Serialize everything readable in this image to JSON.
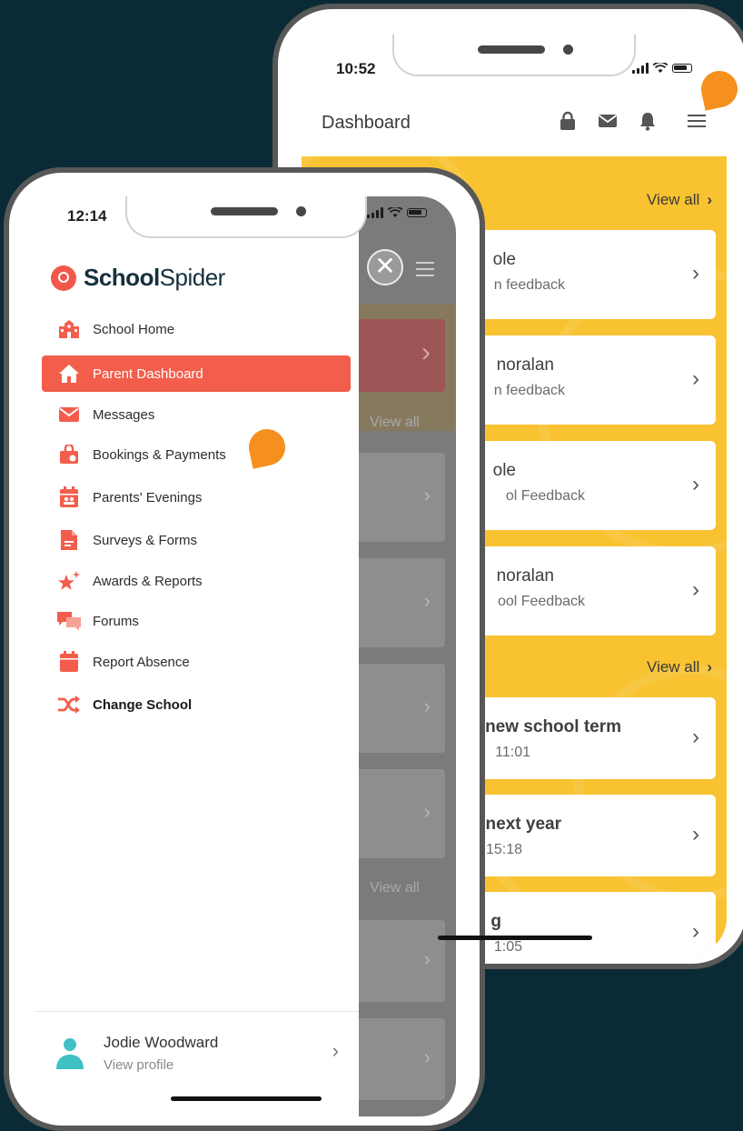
{
  "back_phone": {
    "time": "10:52",
    "header": {
      "title": "Dashboard"
    },
    "icons": {
      "lock": "lock-icon",
      "mail": "mail-icon",
      "bell": "bell-icon",
      "menu": "hamburger-icon"
    },
    "sections": [
      {
        "view_all": "View all"
      },
      {
        "view_all": "View all"
      }
    ],
    "cards": [
      {
        "title": "ole",
        "subtitle": "n feedback"
      },
      {
        "title": "noralan",
        "subtitle": "n feedback"
      },
      {
        "title": "ole",
        "subtitle": "ol Feedback"
      },
      {
        "title": "noralan",
        "subtitle": "ool Feedback"
      },
      {
        "title": "new school term",
        "subtitle": "11:01"
      },
      {
        "title": "next year",
        "subtitle": "15:18"
      },
      {
        "title": "g",
        "subtitle": "1:05"
      }
    ],
    "chevron": "›"
  },
  "front_phone": {
    "time": "12:14",
    "logo": {
      "bold": "School",
      "thin": "Spider"
    },
    "close_glyph": "✕",
    "menu": [
      {
        "label": "School Home",
        "icon": "school-icon"
      },
      {
        "label": "Parent Dashboard",
        "icon": "home-icon",
        "active": true
      },
      {
        "label": "Messages",
        "icon": "mail-icon"
      },
      {
        "label": "Bookings & Payments",
        "icon": "shopping-bag-icon"
      },
      {
        "label": "Parents' Evenings",
        "icon": "calendar-people-icon"
      },
      {
        "label": "Surveys & Forms",
        "icon": "document-icon"
      },
      {
        "label": "Awards & Reports",
        "icon": "star-icon"
      },
      {
        "label": "Forums",
        "icon": "chat-bubbles-icon"
      },
      {
        "label": "Report Absence",
        "icon": "calendar-icon"
      },
      {
        "label": "Change School",
        "icon": "shuffle-icon"
      }
    ],
    "dimmed": {
      "view_all_1": "View all",
      "view_all_2": "View all",
      "chevron": "›"
    },
    "profile": {
      "name": "Jodie Woodward",
      "subtitle": "View profile",
      "chevron": "›"
    }
  },
  "colors": {
    "background": "#0a2a36",
    "accent": "#f35d4c",
    "yellow": "#f8c231",
    "pin": "#f5901e"
  }
}
